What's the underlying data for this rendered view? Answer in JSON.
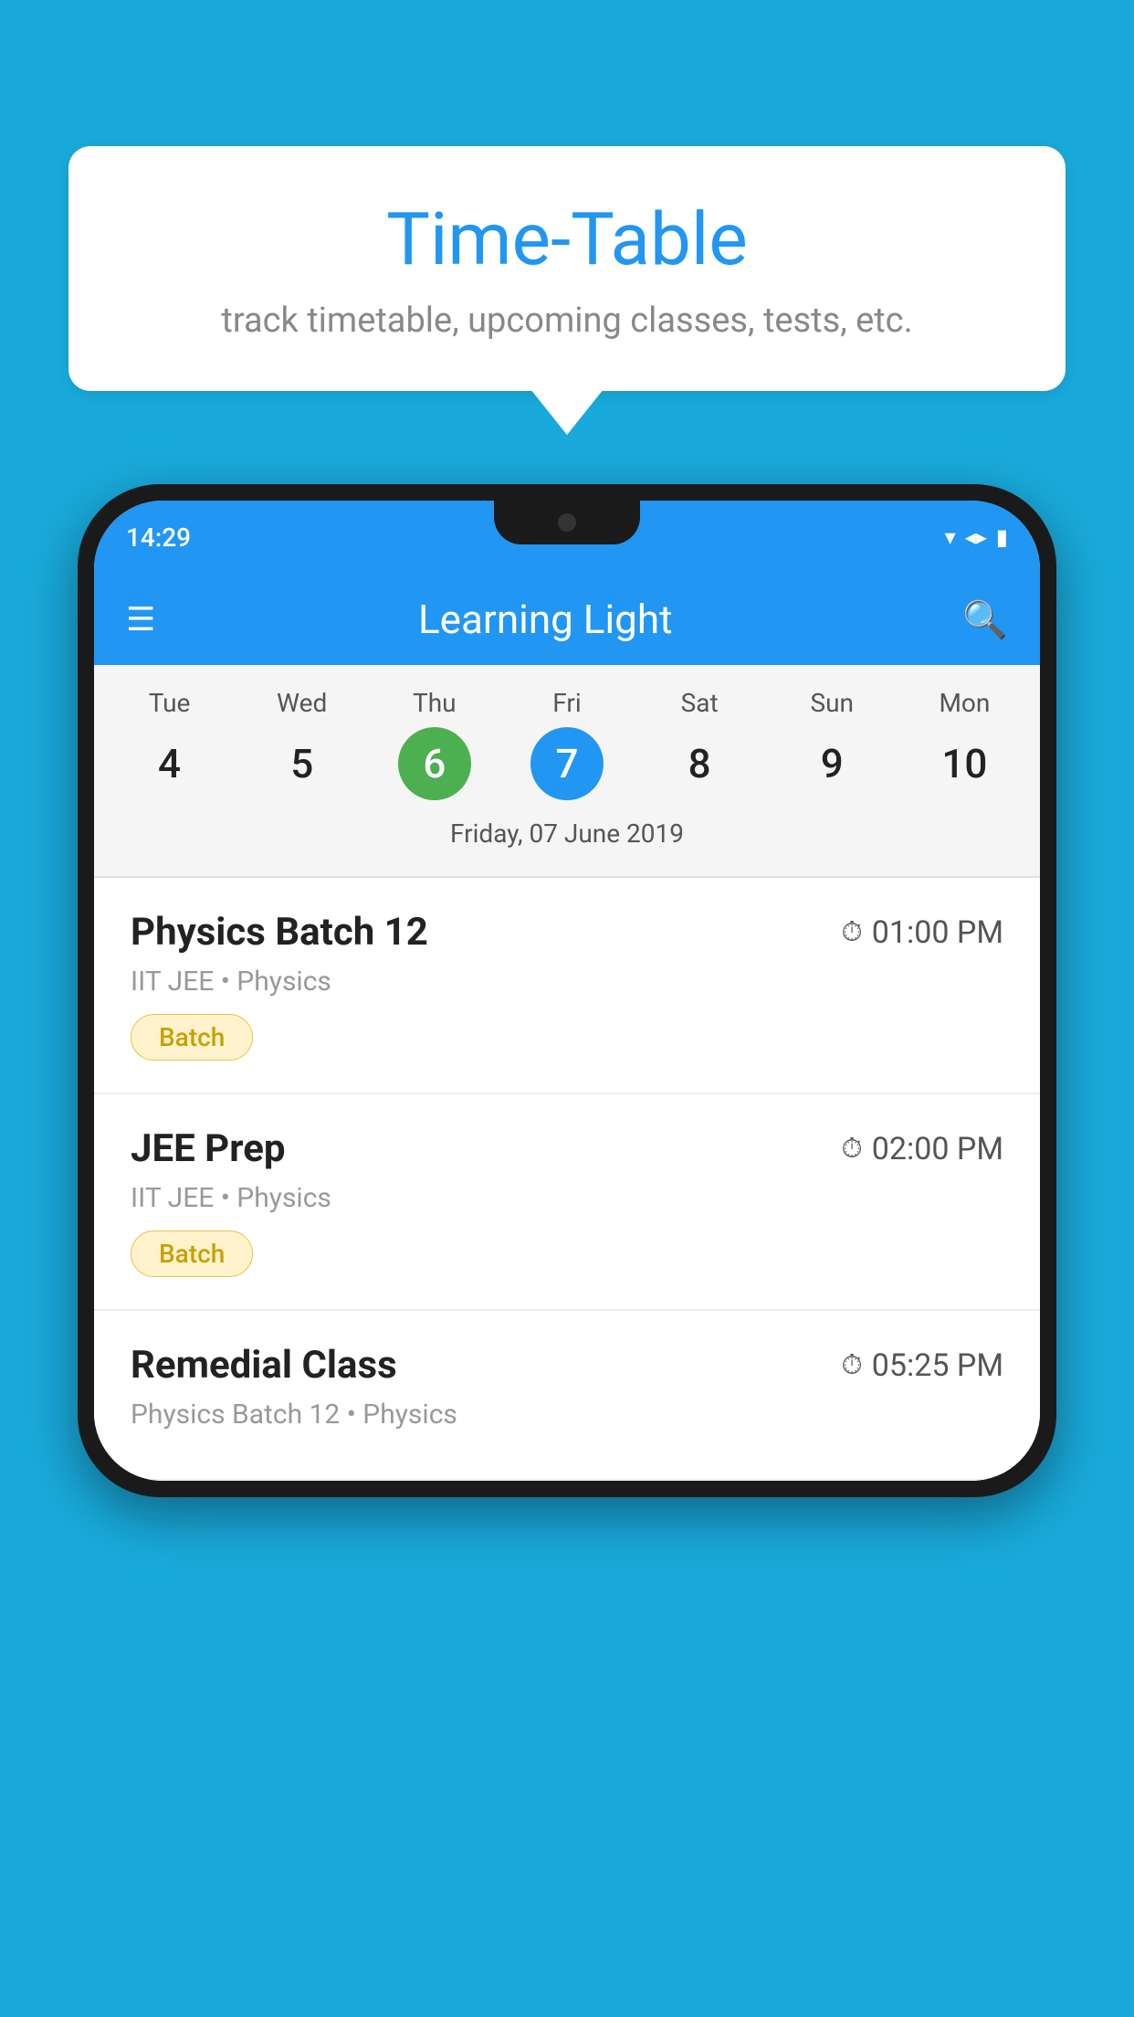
{
  "background_color": "#19AADB",
  "bubble": {
    "title": "Time-Table",
    "subtitle": "track timetable, upcoming classes, tests, etc."
  },
  "phone": {
    "status_bar": {
      "time": "14:29"
    },
    "app_bar": {
      "title": "Learning Light"
    },
    "calendar": {
      "days": [
        {
          "name": "Tue",
          "num": "4",
          "state": "normal"
        },
        {
          "name": "Wed",
          "num": "5",
          "state": "normal"
        },
        {
          "name": "Thu",
          "num": "6",
          "state": "today"
        },
        {
          "name": "Fri",
          "num": "7",
          "state": "selected"
        },
        {
          "name": "Sat",
          "num": "8",
          "state": "normal"
        },
        {
          "name": "Sun",
          "num": "9",
          "state": "normal"
        },
        {
          "name": "Mon",
          "num": "10",
          "state": "normal"
        }
      ],
      "selected_date_label": "Friday, 07 June 2019"
    },
    "classes": [
      {
        "name": "Physics Batch 12",
        "time": "01:00 PM",
        "detail": "IIT JEE • Physics",
        "badge": "Batch"
      },
      {
        "name": "JEE Prep",
        "time": "02:00 PM",
        "detail": "IIT JEE • Physics",
        "badge": "Batch"
      },
      {
        "name": "Remedial Class",
        "time": "05:25 PM",
        "detail": "Physics Batch 12 • Physics",
        "badge": null
      }
    ]
  },
  "icons": {
    "hamburger": "≡",
    "search": "🔍",
    "clock": "🕐",
    "wifi": "▼",
    "signal": "▲",
    "battery": "▮"
  }
}
